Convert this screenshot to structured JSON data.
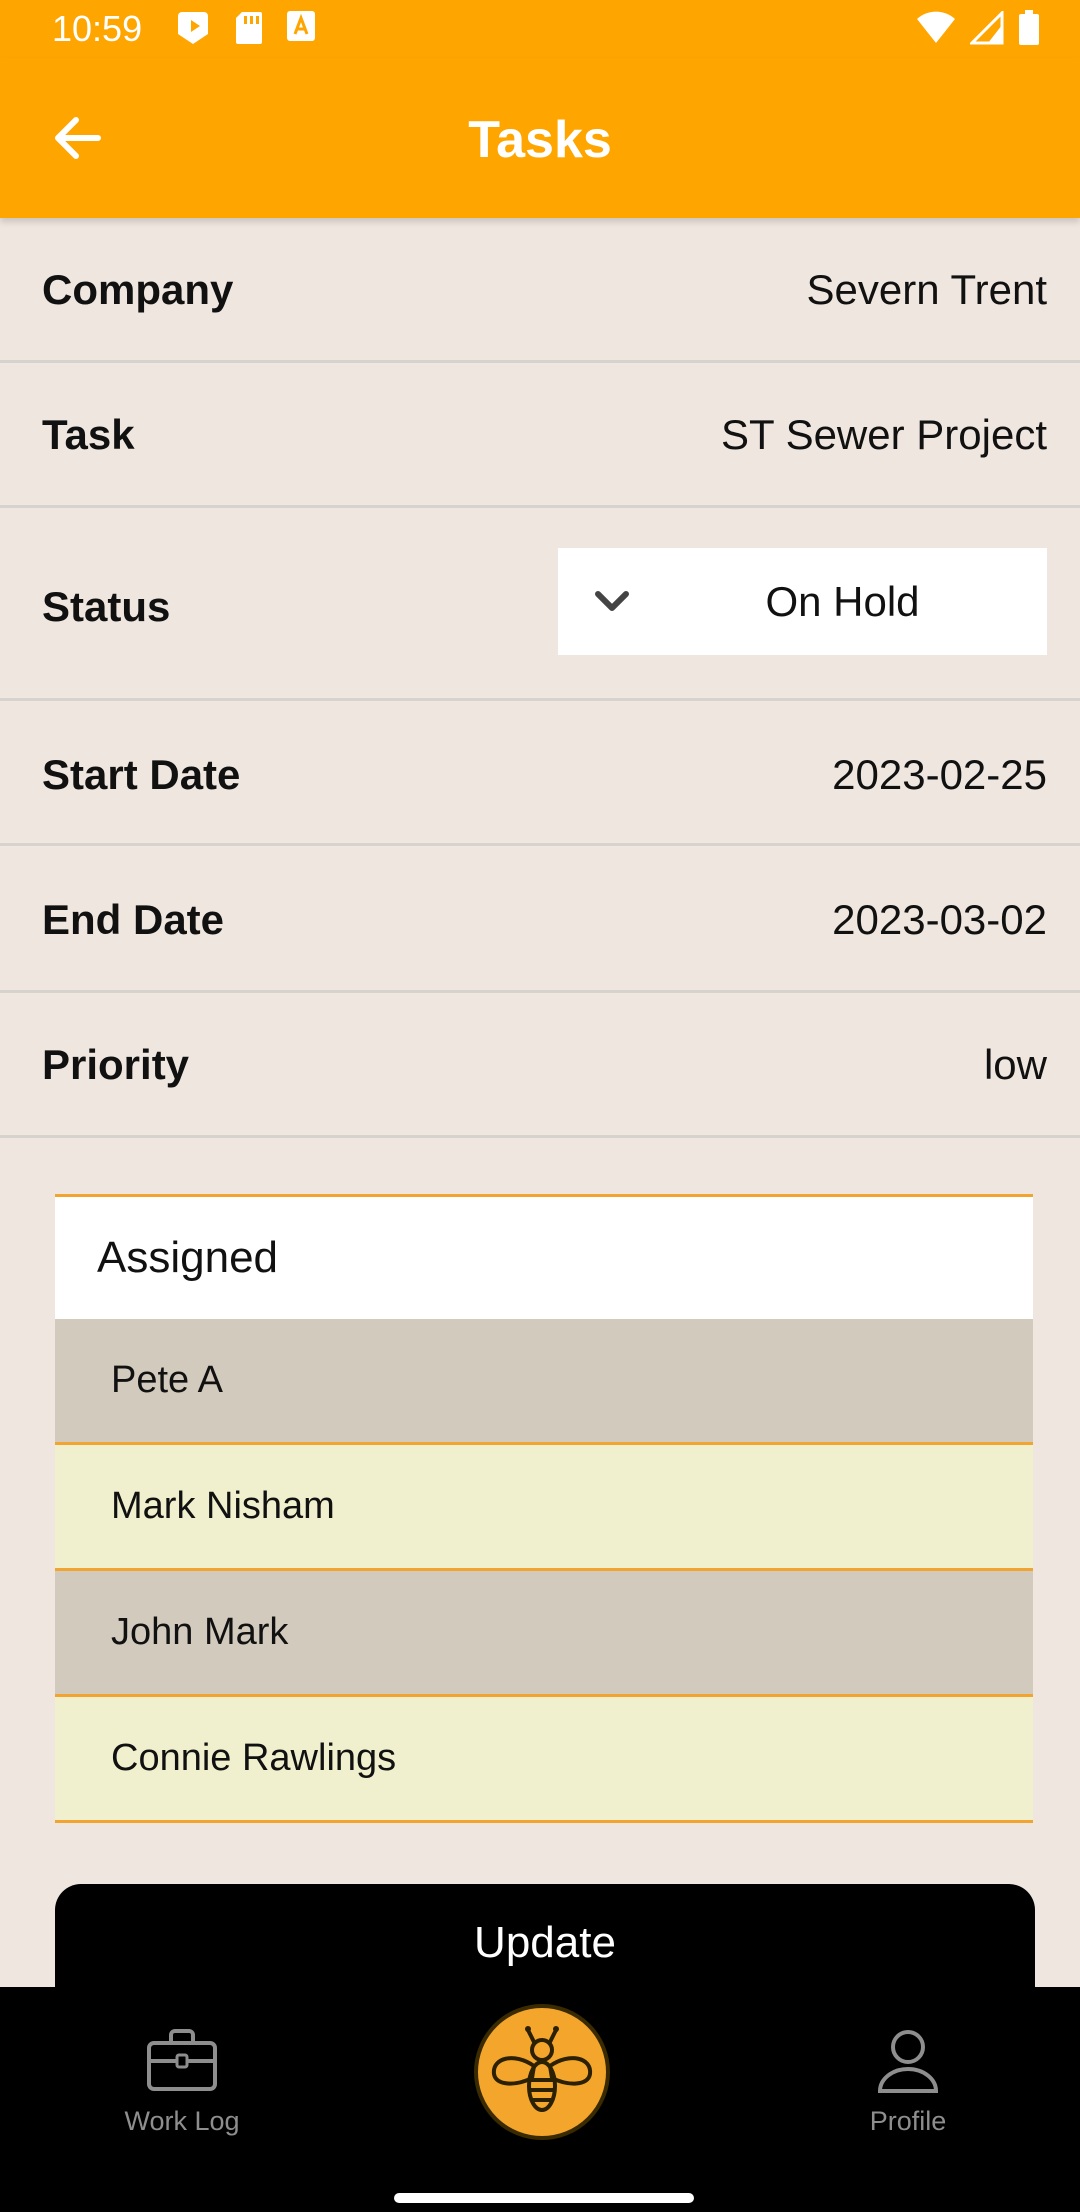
{
  "status_bar": {
    "time": "10:59"
  },
  "app_bar": {
    "title": "Tasks",
    "back_icon": "arrow-left-icon"
  },
  "details": {
    "company": {
      "label": "Company",
      "value": "Severn Trent"
    },
    "task": {
      "label": "Task",
      "value": "ST Sewer Project"
    },
    "status": {
      "label": "Status",
      "value": "On Hold"
    },
    "start_date": {
      "label": "Start Date",
      "value": "2023-02-25"
    },
    "end_date": {
      "label": "End Date",
      "value": "2023-03-02"
    },
    "priority": {
      "label": "Priority",
      "value": "low"
    }
  },
  "assigned": {
    "title": "Assigned",
    "people": [
      "Pete A",
      "Mark Nisham",
      "John Mark",
      "Connie Rawlings"
    ]
  },
  "update_label": "Update",
  "bottom_nav": {
    "work_log": "Work Log",
    "profile": "Profile"
  },
  "colors": {
    "accent": "#FFA500",
    "background": "#EFE6DF",
    "row_alt_dark": "#D2CABC",
    "row_alt_light": "#F0F0CE"
  }
}
